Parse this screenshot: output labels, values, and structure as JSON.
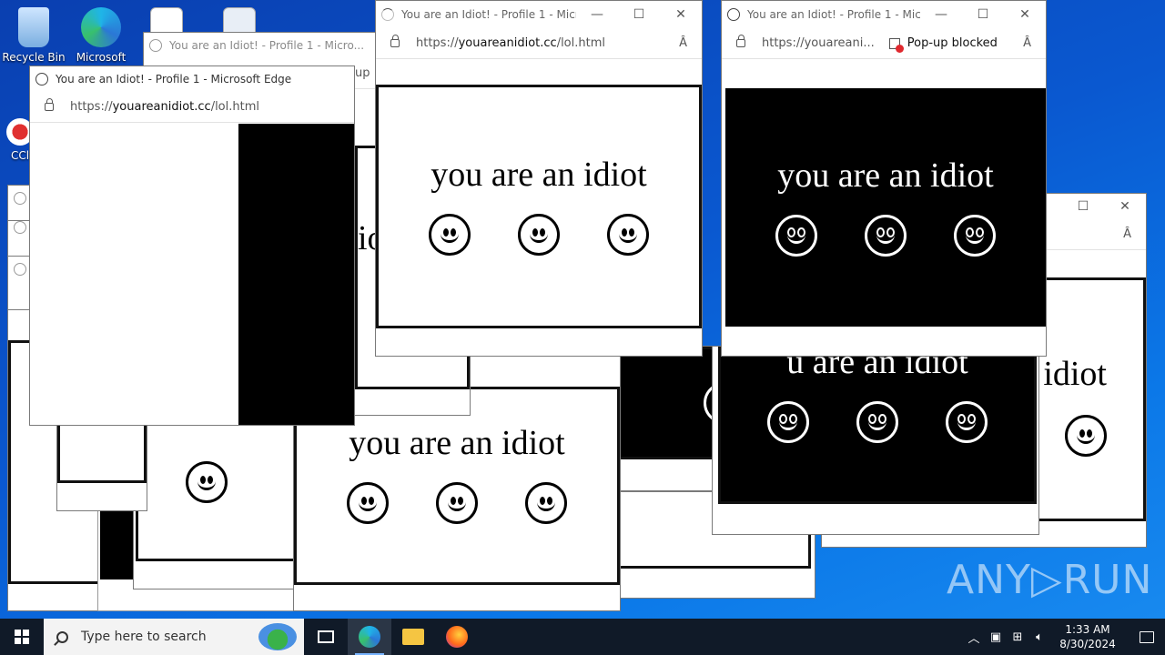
{
  "desktop": {
    "icons": [
      {
        "label": "Recycle Bin",
        "icon": "recycle-bin-icon"
      },
      {
        "label": "Microsoft",
        "icon": "edge-icon"
      },
      {
        "label": "CCl",
        "icon": "ccleaner-icon"
      }
    ]
  },
  "window": {
    "title": "You are an Idiot! - Profile 1 - Microsoft Edge",
    "title_short": "You are an Idiot! - Profile 1 - Micro...",
    "url_prefix": "https://",
    "url_domain": "youareanidiot.cc",
    "url_path": "/lol.html",
    "url_truncated": "https://youareani...",
    "popup_blocked": "Pop-up blocked",
    "minimize": "—",
    "maximize": "☐",
    "close": "✕",
    "read_aloud": "Ȃ"
  },
  "page": {
    "phrase": "you are an idiot",
    "fragment_text_1": "n",
    "fragment_text_2": "op-",
    "fragment_text_3": "up",
    "fragment_text_4": "io",
    "fragment_text_5": "idiot",
    "fragment_text_6": "u are an idiot"
  },
  "taskbar": {
    "search_placeholder": "Type here to search",
    "time": "1:33 AM",
    "date": "8/30/2024",
    "apps": [
      "task-view-icon",
      "edge-icon",
      "file-explorer-icon",
      "firefox-icon"
    ]
  },
  "watermark": "ANY▷RUN",
  "colors": {
    "desktop": "#0a58d0",
    "taskbar": "#101a28",
    "popup_blocked": "#e0282e"
  }
}
